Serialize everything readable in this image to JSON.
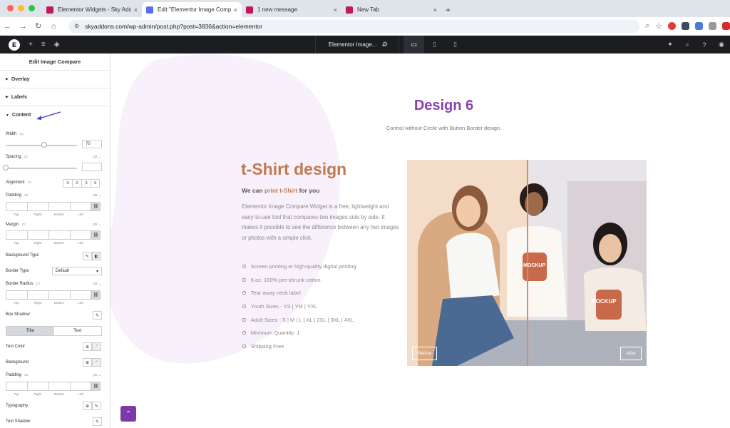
{
  "browser": {
    "tabs": [
      {
        "title": "Elementor Widgets - Sky Add",
        "color": "#c2185b",
        "active": false
      },
      {
        "title": "Edit \"Elementor Image Compa",
        "color": "#5b6cf5",
        "active": true
      },
      {
        "title": "1 new message",
        "color": "#c2185b",
        "active": false
      },
      {
        "title": "New Tab",
        "color": "#c2185b",
        "active": false
      }
    ],
    "url": "skyaddons.com/wp-admin/post.php?post=3836&action=elementor"
  },
  "editor": {
    "doc_name": "Elementor Image...",
    "panel_title": "Edit Image Compare",
    "sections": {
      "overlay": "Overlay",
      "labels": "Labels",
      "content": "Content"
    },
    "controls": {
      "width": "Width",
      "width_value": "70",
      "width_fraction": 0.7,
      "spacing": "Spacing",
      "unit_px": "px",
      "alignment": "Alignment",
      "padding": "Padding",
      "margin": "Margin",
      "dims": [
        "Top",
        "Right",
        "Bottom",
        "Left"
      ],
      "background_type": "Background Type",
      "border_type": "Border Type",
      "border_type_value": "Default",
      "border_radius": "Border Radius",
      "box_shadow": "Box Shadow",
      "tab_title": "Title",
      "tab_text": "Text",
      "text_color": "Text Color",
      "background": "Background",
      "padding2": "Padding",
      "typography": "Typography",
      "text_shadow": "Text Shadow"
    }
  },
  "page": {
    "heading": "Design 6",
    "subheading": "Control without Circle with Button Border design.",
    "product_title": "t-Shirt design",
    "tagline_pre": "We can ",
    "tagline_link": "print t-Shirt",
    "tagline_post": " for you",
    "description": "Elementor Image Compare Widget is a free, lightweight and easy-to-use tool that compares two images side by side. It makes it possible to see the difference between any two images or photos with a simple click.",
    "features": [
      "Screen printing or high-quality digital printing",
      "6 oz. 100% pre-shrunk cotton",
      "Tear away neck label",
      "Youth Sizes - YS | YM | YXL",
      "Adult Sizes - S | M | L | XL | 2XL | 3XL | 4XL",
      "Minimum Quantity: 1",
      "Shipping Free"
    ],
    "compare": {
      "before": "Before",
      "after": "After",
      "split_fraction": 0.5,
      "mockup_text": "MOCKUP"
    },
    "colors": {
      "heading": "#8a3fae",
      "product": "#c07a4f",
      "link": "#c07a4f"
    }
  }
}
